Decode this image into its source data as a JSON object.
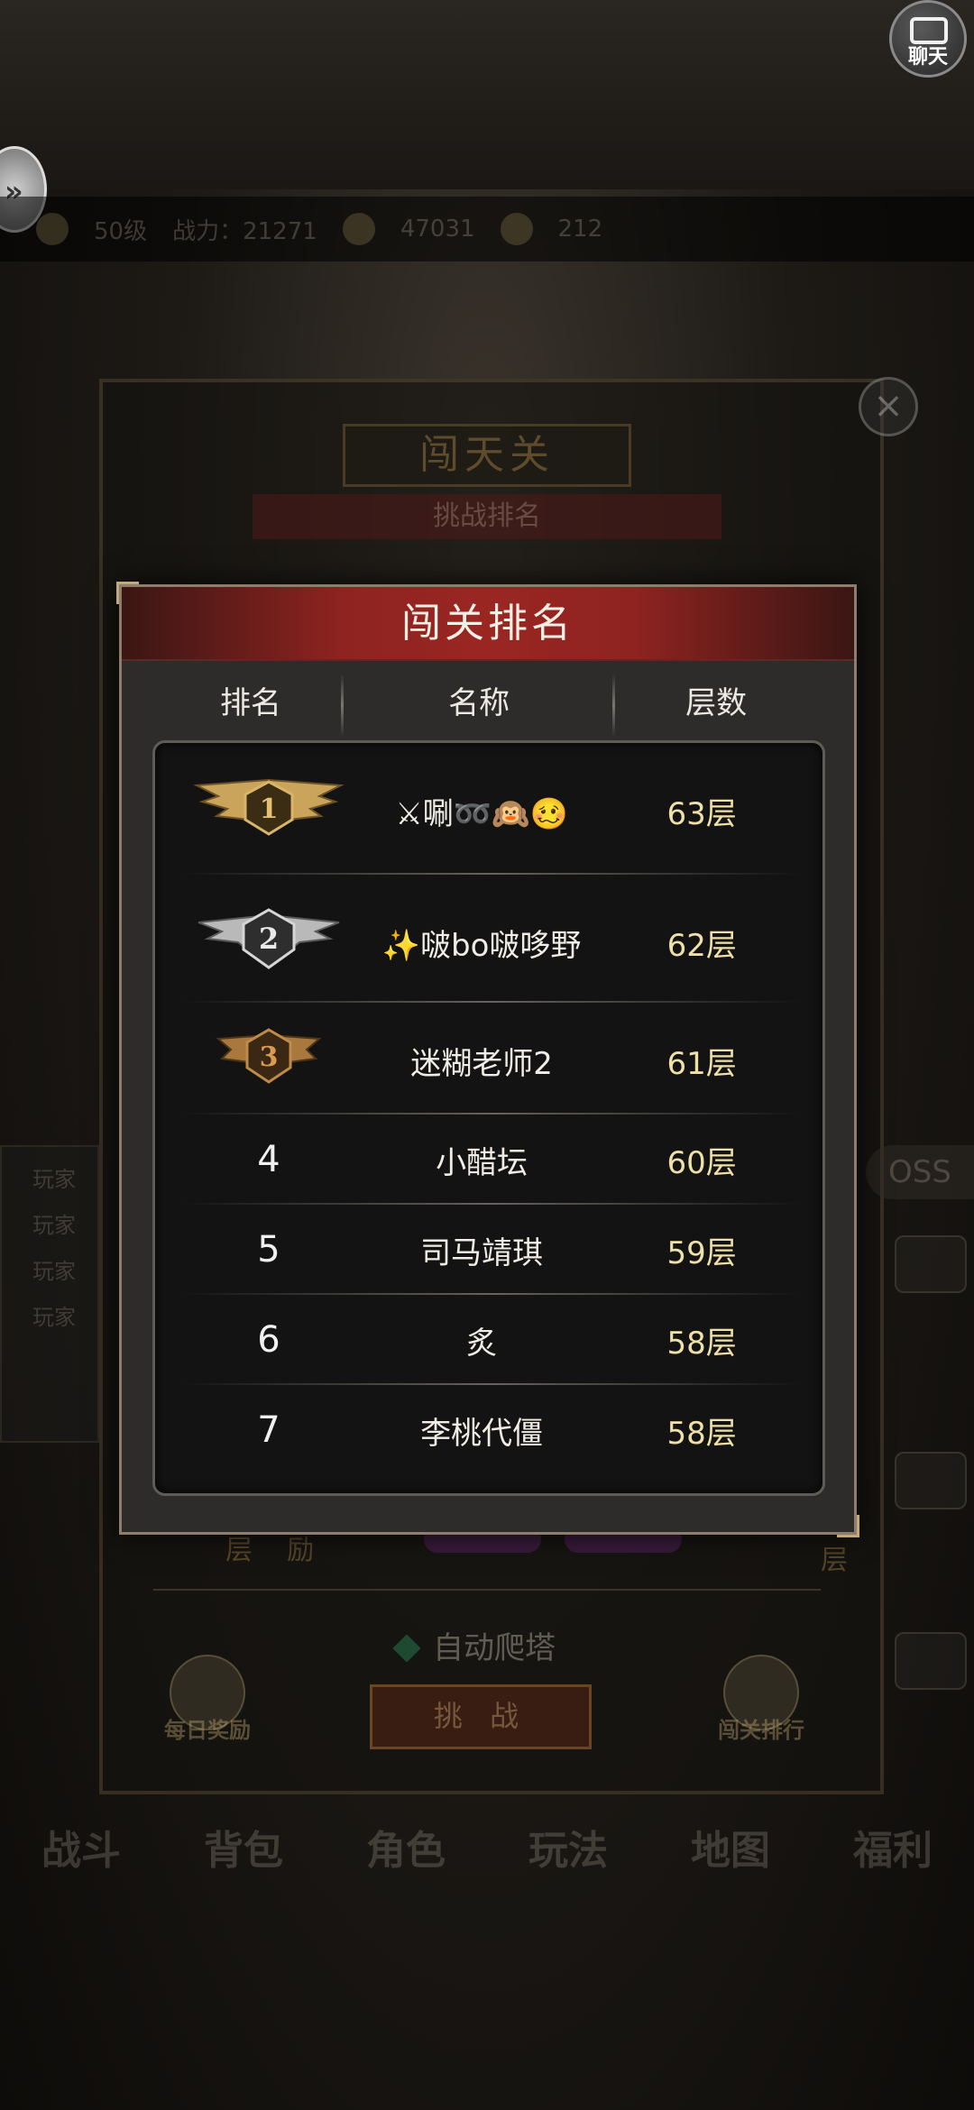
{
  "background": {
    "chat_label": "聊天",
    "status_bar": {
      "level": "50级",
      "power_label": "战力：21271",
      "gold": "47031",
      "ingot": "212"
    },
    "stage_title": "闯天关",
    "stage_subtitle": "挑战排名",
    "floor_label": "层",
    "reward_label": "励",
    "side_labels": [
      "玩家",
      "玩家",
      "玩家",
      "玩家"
    ],
    "auto_climb_label": "自动爬塔",
    "daily_reward_label": "每日奖励",
    "challenge_label": "挑 战",
    "ranking_label": "闯关排行",
    "bottom_nav": [
      "战斗",
      "背包",
      "角色",
      "玩法",
      "地图",
      "福利"
    ]
  },
  "modal": {
    "title": "闯关排名",
    "columns": {
      "rank": "排名",
      "name": "名称",
      "floor": "层数"
    },
    "rows": [
      {
        "rank": "1",
        "name": "⚔唰➿🙉🥴",
        "floor": "63层",
        "badge": "gold"
      },
      {
        "rank": "2",
        "name": "✨啵bo啵哆野",
        "floor": "62层",
        "badge": "silver"
      },
      {
        "rank": "3",
        "name": "迷糊老师2",
        "floor": "61层",
        "badge": "bronze"
      },
      {
        "rank": "4",
        "name": "小醋坛",
        "floor": "60层"
      },
      {
        "rank": "5",
        "name": "司马靖琪",
        "floor": "59层"
      },
      {
        "rank": "6",
        "name": "炙",
        "floor": "58层"
      },
      {
        "rank": "7",
        "name": "李桃代僵",
        "floor": "58层"
      }
    ]
  },
  "colors": {
    "header_red": "#9a2622",
    "gold": "#c9a45a",
    "silver": "#bfbfbf",
    "bronze": "#a8783e",
    "floor_text": "#efe0a8"
  }
}
